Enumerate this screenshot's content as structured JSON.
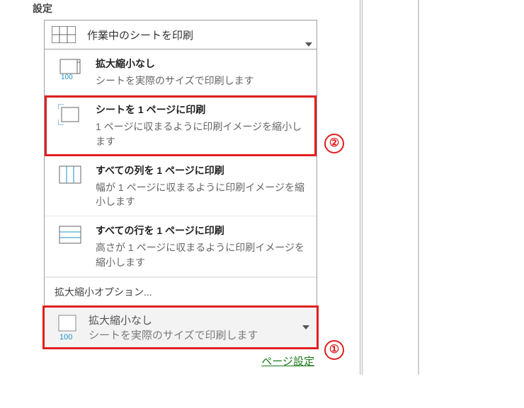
{
  "section_title": "設定",
  "top_combo": {
    "label": "作業中のシートを印刷"
  },
  "options": [
    {
      "title": "拡大縮小なし",
      "desc": "シートを実際のサイズで印刷します"
    },
    {
      "title": "シートを 1 ページに印刷",
      "desc": "1 ページに収まるように印刷イメージを縮小します"
    },
    {
      "title": "すべての列を 1 ページに印刷",
      "desc": "幅が 1 ページに収まるように印刷イメージを縮小します"
    },
    {
      "title": "すべての行を 1 ページに印刷",
      "desc": "高さが 1 ページに収まるように印刷イメージを縮小します"
    }
  ],
  "more_options": "拡大縮小オプション...",
  "bottom_combo": {
    "title": "拡大縮小なし",
    "desc": "シートを実際のサイズで印刷します"
  },
  "page_setup": "ページ設定",
  "callouts": {
    "c1": "①",
    "c2": "②"
  },
  "icons": {
    "grid": "grid-icon",
    "page100": "page-100-icon",
    "fit": "fit-page-icon",
    "cols": "fit-columns-icon",
    "rows": "fit-rows-icon",
    "caret": "caret-down-icon"
  }
}
